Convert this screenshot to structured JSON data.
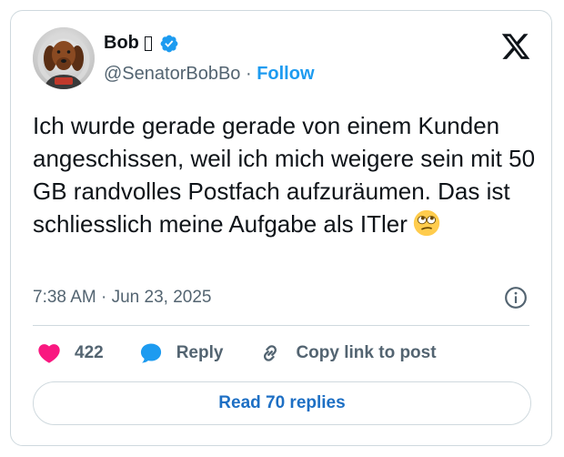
{
  "author": {
    "name": "Bob",
    "handle": "@SenatorBobBo",
    "separator": "·",
    "follow_label": "Follow",
    "verified": true
  },
  "tweet": {
    "text": "Ich wurde gerade gerade von einem Kunden angeschissen, weil ich mich weigere sein mit 50 GB randvolles Postfach aufzuräumen. Das ist schliesslich meine Aufgabe als ITler",
    "emoji": "face-with-rolling-eyes",
    "timestamp": "7:38 AM · Jun 23, 2025"
  },
  "actions": {
    "like_count": "422",
    "reply_label": "Reply",
    "copy_link_label": "Copy link to post"
  },
  "footer": {
    "read_replies_label": "Read 70 replies"
  },
  "colors": {
    "accent": "#1d9bf0",
    "like": "#f91880",
    "muted": "#536471",
    "border": "#cfd9de"
  }
}
